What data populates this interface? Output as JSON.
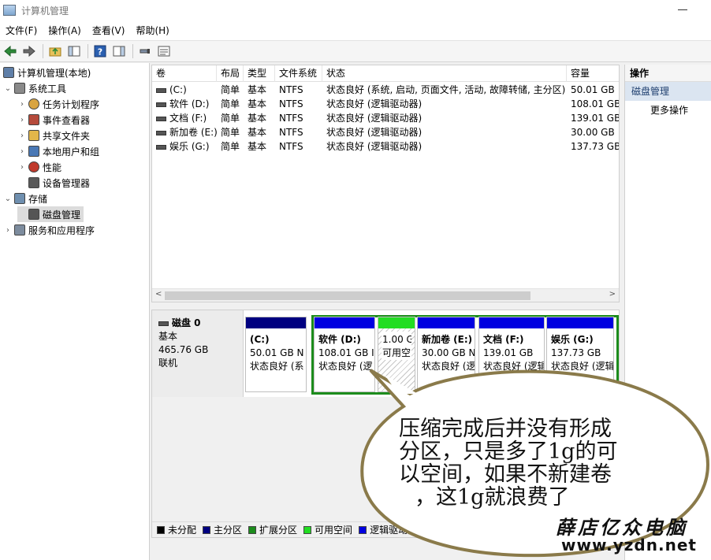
{
  "window": {
    "title": "计算机管理"
  },
  "menu": [
    "文件(F)",
    "操作(A)",
    "查看(V)",
    "帮助(H)"
  ],
  "tree": [
    {
      "label": "计算机管理(本地)",
      "indent": 0,
      "chevron": "",
      "icon": "computer-mgmt-icon"
    },
    {
      "label": "系统工具",
      "indent": 1,
      "chevron": "⌄",
      "icon": "tools-icon"
    },
    {
      "label": "任务计划程序",
      "indent": 2,
      "chevron": "›",
      "icon": "clock-icon"
    },
    {
      "label": "事件查看器",
      "indent": 2,
      "chevron": "›",
      "icon": "event-viewer-icon"
    },
    {
      "label": "共享文件夹",
      "indent": 2,
      "chevron": "›",
      "icon": "shared-folder-icon"
    },
    {
      "label": "本地用户和组",
      "indent": 2,
      "chevron": "›",
      "icon": "users-icon"
    },
    {
      "label": "性能",
      "indent": 2,
      "chevron": "›",
      "icon": "performance-icon"
    },
    {
      "label": "设备管理器",
      "indent": 2,
      "chevron": "",
      "icon": "device-manager-icon"
    },
    {
      "label": "存储",
      "indent": 1,
      "chevron": "⌄",
      "icon": "storage-icon"
    },
    {
      "label": "磁盘管理",
      "indent": 2,
      "chevron": "",
      "icon": "disk-icon",
      "selected": true
    },
    {
      "label": "服务和应用程序",
      "indent": 1,
      "chevron": "›",
      "icon": "services-icon"
    }
  ],
  "volume_table": {
    "columns": [
      "卷",
      "布局",
      "类型",
      "文件系统",
      "状态",
      "容量"
    ],
    "rows": [
      [
        "(C:)",
        "简单",
        "基本",
        "NTFS",
        "状态良好 (系统, 启动, 页面文件, 活动, 故障转储, 主分区)",
        "50.01 GB"
      ],
      [
        "软件 (D:)",
        "简单",
        "基本",
        "NTFS",
        "状态良好 (逻辑驱动器)",
        "108.01 GB"
      ],
      [
        "文档 (F:)",
        "简单",
        "基本",
        "NTFS",
        "状态良好 (逻辑驱动器)",
        "139.01 GB"
      ],
      [
        "新加卷 (E:)",
        "简单",
        "基本",
        "NTFS",
        "状态良好 (逻辑驱动器)",
        "30.00 GB"
      ],
      [
        "娱乐 (G:)",
        "简单",
        "基本",
        "NTFS",
        "状态良好 (逻辑驱动器)",
        "137.73 GB"
      ]
    ]
  },
  "disk": {
    "name": "磁盘 0",
    "type": "基本",
    "size": "465.76 GB",
    "status": "联机",
    "partitions": [
      {
        "name": "(C:)",
        "size": "50.01 GB N",
        "status": "状态良好 (系",
        "color": "#000080"
      },
      {
        "name": "软件  (D:)",
        "size": "108.01 GB I",
        "status": "状态良好 (逻",
        "color": "#0000e0"
      },
      {
        "name": "",
        "size": "1.00 G",
        "status": "可用空",
        "color": "#22dd22"
      },
      {
        "name": "新加卷  (E:)",
        "size": "30.00 GB N",
        "status": "状态良好 (逻",
        "color": "#0000e0"
      },
      {
        "name": "文档  (F:)",
        "size": "139.01 GB",
        "status": "状态良好 (逻辑",
        "color": "#0000e0"
      },
      {
        "name": "娱乐  (G:)",
        "size": "137.73 GB",
        "status": "状态良好 (逻辑",
        "color": "#0000e0"
      }
    ]
  },
  "legend": [
    {
      "label": "未分配",
      "color": "#000000"
    },
    {
      "label": "主分区",
      "color": "#000080"
    },
    {
      "label": "扩展分区",
      "color": "#1c8c1c"
    },
    {
      "label": "可用空间",
      "color": "#22dd22"
    },
    {
      "label": "逻辑驱动器",
      "color": "#0000e0"
    }
  ],
  "actions": {
    "header": "操作",
    "selected": "磁盘管理",
    "more": "更多操作"
  },
  "annotation": {
    "lines": [
      "压缩完成后并没有形成",
      "分区，只是多了1g的可",
      "以空间，如果不新建卷",
      "，这1g就浪费了"
    ]
  },
  "watermark": {
    "line1": "薛店亿众电脑",
    "line2": "www.yzdn.net"
  }
}
